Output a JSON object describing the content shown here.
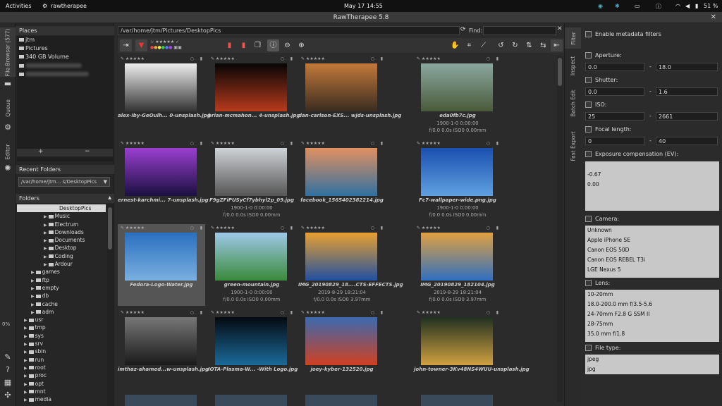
{
  "topbar": {
    "activities": "Activities",
    "app": "rawtherapee",
    "clock": "May 17  14:55",
    "battery": "51 %"
  },
  "window": {
    "title": "RawTherapee 5.8"
  },
  "left_tabs": [
    "File Browser (577)",
    "Queue",
    "Editor"
  ],
  "left_percent": "0%",
  "places": {
    "header": "Places",
    "items": [
      "jtm",
      "Pictures",
      "340 GB Volume"
    ]
  },
  "recent": {
    "header": "Recent Folders",
    "value": "/var/home/jtm... s/DesktopPics"
  },
  "folders": {
    "header": "Folders",
    "selected": "DesktopPics",
    "sub": [
      "Music",
      "Electrum",
      "Downloads",
      "Documents",
      "Desktop",
      "Coding",
      "Ardour"
    ],
    "mid": [
      "games",
      "ftp",
      "empty",
      "db",
      "cache",
      "adm"
    ],
    "top": [
      "usr",
      "tmp",
      "sys",
      "srv",
      "sbin",
      "run",
      "root",
      "proc",
      "opt",
      "mnt",
      "media"
    ]
  },
  "browser": {
    "path": "/var/home/jtm/Pictures/DesktopPics",
    "find_label": "Find:"
  },
  "thumbnails": [
    {
      "name": "alex-iby-GeOulh... 0-unsplash.jpg",
      "l2": "",
      "l3": "",
      "colors": [
        "#eee",
        "#333"
      ]
    },
    {
      "name": "brian-mcmahon... 4-unsplash.jpg",
      "l2": "",
      "l3": "",
      "colors": [
        "#050505",
        "#b83a1c"
      ]
    },
    {
      "name": "dan-carlson-EXS... wjds-unsplash.jpg",
      "l2": "",
      "l3": "",
      "colors": [
        "#c2793a",
        "#3a2c20"
      ]
    },
    {
      "name": "eda0fb7c.jpg",
      "l2": "1900-1-0 0:00:00",
      "l3": "f/0.0 0.0s ISO0 0.00mm",
      "colors": [
        "#8aa8a0",
        "#4a5a3a"
      ]
    },
    {
      "name": "ernest-karchmi... 7-unsplash.jpg",
      "l2": "",
      "l3": "",
      "colors": [
        "#9a3fd0",
        "#1a1040"
      ]
    },
    {
      "name": "F9gZFiPUSyCf7ybhyl2p_09.jpg",
      "l2": "1900-1-0 0:00:00",
      "l3": "f/0.0 0.0s ISO0 0.00mm",
      "colors": [
        "#cfd2d6",
        "#555"
      ]
    },
    {
      "name": "facebook_1565402382214.jpg",
      "l2": "",
      "l3": "",
      "colors": [
        "#e09060",
        "#3070a0"
      ]
    },
    {
      "name": "Fc7-wallpaper-wide.png.jpg",
      "l2": "1900-1-0 0:00:00",
      "l3": "f/0.0 0.0s ISO0 0.00mm",
      "colors": [
        "#1a50b0",
        "#60a0e0"
      ]
    },
    {
      "name": "Fedora-Logo-Water.jpg",
      "l2": "",
      "l3": "",
      "colors": [
        "#2a70c0",
        "#7ab0e0"
      ]
    },
    {
      "name": "green-mountain.jpg",
      "l2": "1900-1-0 0:00:00",
      "l3": "f/0.0 0.0s ISO0 0.00mm",
      "colors": [
        "#9ec8e8",
        "#3a8a3a"
      ]
    },
    {
      "name": "IMG_20190829_18....CTS-EFFECTS.jpg",
      "l2": "2019-8-29 18:21:04",
      "l3": "f/0.0 0.0s ISO0 3.97mm",
      "colors": [
        "#e8a030",
        "#2050a0"
      ]
    },
    {
      "name": "IMG_20190829_182104.jpg",
      "l2": "2019-8-29 18:21:04",
      "l3": "f/0.0 0.0s ISO0 3.97mm",
      "colors": [
        "#e0a040",
        "#3070c0"
      ]
    },
    {
      "name": "imthaz-ahamed...w-unsplash.jpg",
      "l2": "",
      "l3": "",
      "colors": [
        "#777",
        "#1a1a1a"
      ]
    },
    {
      "name": "IOTA-Plasma-W... -With Logo.jpg",
      "l2": "",
      "l3": "",
      "colors": [
        "#050a10",
        "#1a6a9a"
      ]
    },
    {
      "name": "joey-kyber-132520.jpg",
      "l2": "",
      "l3": "",
      "colors": [
        "#3a6ab0",
        "#d04020"
      ]
    },
    {
      "name": "john-towner-3Kv48NS4WUU-unsplash.jpg",
      "l2": "",
      "l3": "",
      "colors": [
        "#203020",
        "#d0a040"
      ]
    }
  ],
  "right_tabs": [
    "Filter",
    "Inspect",
    "Batch Edit",
    "Fast Export"
  ],
  "filter": {
    "enable_metadata": "Enable metadata filters",
    "aperture": {
      "label": "Aperture:",
      "from": "0.0",
      "to": "18.0"
    },
    "shutter": {
      "label": "Shutter:",
      "from": "0.0",
      "to": "1.6"
    },
    "iso": {
      "label": "ISO:",
      "from": "25",
      "to": "2661"
    },
    "focal": {
      "label": "Focal length:",
      "from": "0",
      "to": "40"
    },
    "exposure": {
      "label": "Exposure compensation (EV):",
      "items": [
        "-0.67",
        "0.00"
      ]
    },
    "camera": {
      "label": "Camera:",
      "items": [
        "Unknown",
        "Apple iPhone SE",
        "Canon EOS 50D",
        "Canon EOS REBEL T3i",
        "LGE Nexus 5"
      ]
    },
    "lens": {
      "label": "Lens:",
      "items": [
        "10-20mm",
        "18.0-200.0 mm f/3.5-5.6",
        "24-70mm F2.8 G SSM II",
        "28-75mm",
        "35.0 mm f/1.8"
      ]
    },
    "filetype": {
      "label": "File type:",
      "items": [
        "jpeg",
        "jpg"
      ]
    },
    "dash": "-"
  }
}
